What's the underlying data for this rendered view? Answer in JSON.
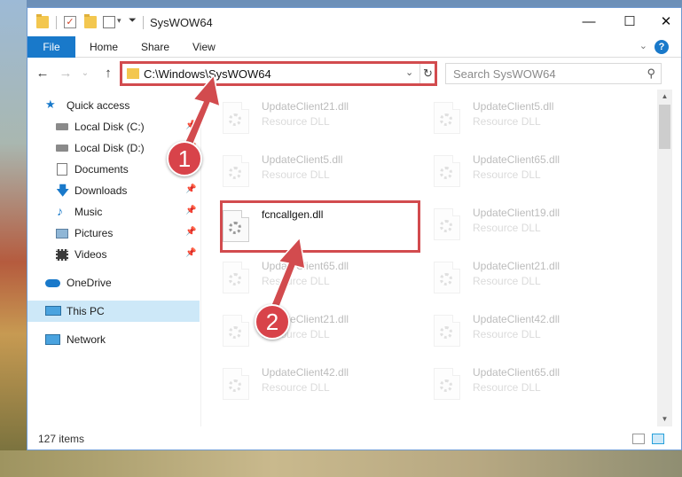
{
  "window": {
    "title": "SysWOW64",
    "min_glyph": "—",
    "max_glyph": "☐",
    "close_glyph": "✕"
  },
  "ribbon": {
    "tabs": [
      "File",
      "Home",
      "Share",
      "View"
    ],
    "collapse_glyph": "⌄",
    "help_glyph": "?"
  },
  "nav": {
    "back_glyph": "←",
    "forward_glyph": "→",
    "recent_glyph": "⌄",
    "up_glyph": "↑",
    "address": "C:\\Windows\\SysWOW64",
    "address_drop_glyph": "⌄",
    "refresh_glyph": "↻",
    "search_placeholder": "Search SysWOW64",
    "search_glyph": "⚲"
  },
  "sidebar": {
    "items": [
      {
        "label": "Quick access",
        "icon": "star-icon"
      },
      {
        "label": "Local Disk (C:)",
        "icon": "drive-icon"
      },
      {
        "label": "Local Disk (D:)",
        "icon": "drive-icon"
      },
      {
        "label": "Documents",
        "icon": "documents-icon"
      },
      {
        "label": "Downloads",
        "icon": "download-icon"
      },
      {
        "label": "Music",
        "icon": "music-icon"
      },
      {
        "label": "Pictures",
        "icon": "pictures-icon"
      },
      {
        "label": "Videos",
        "icon": "videos-icon"
      },
      {
        "label": "OneDrive",
        "icon": "cloud-icon"
      },
      {
        "label": "This PC",
        "icon": "computer-icon"
      },
      {
        "label": "Network",
        "icon": "network-icon"
      }
    ],
    "pin_glyph": "📌"
  },
  "files": {
    "left": [
      {
        "name": "UpdateClient21.dll",
        "type": "Resource DLL"
      },
      {
        "name": "UpdateClient5.dll",
        "type": "Resource DLL"
      },
      {
        "name": "fcncallgen.dll",
        "type": ""
      },
      {
        "name": "UpdateClient65.dll",
        "type": "Resource DLL"
      },
      {
        "name": "UpdateClient21.dll",
        "type": "Resource DLL"
      },
      {
        "name": "UpdateClient42.dll",
        "type": "Resource DLL"
      }
    ],
    "right": [
      {
        "name": "UpdateClient5.dll",
        "type": "Resource DLL"
      },
      {
        "name": "UpdateClient65.dll",
        "type": "Resource DLL"
      },
      {
        "name": "UpdateClient19.dll",
        "type": "Resource DLL"
      },
      {
        "name": "UpdateClient21.dll",
        "type": "Resource DLL"
      },
      {
        "name": "UpdateClient42.dll",
        "type": "Resource DLL"
      },
      {
        "name": "UpdateClient65.dll",
        "type": "Resource DLL"
      }
    ]
  },
  "status": {
    "count": "127 items"
  },
  "annotations": {
    "step1": "1",
    "step2": "2",
    "color": "#d24b4e"
  }
}
